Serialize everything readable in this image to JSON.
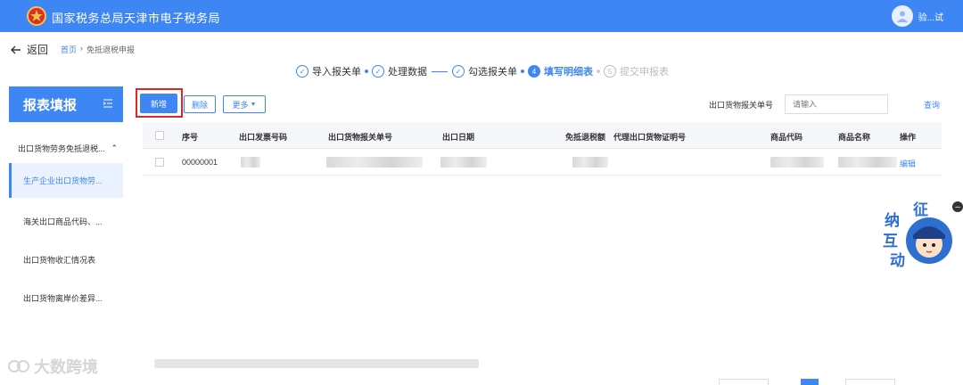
{
  "header": {
    "title": "国家税务总局天津市电子税务局",
    "user_name": "验...试",
    "bg_color": "#3f86f5"
  },
  "nav": {
    "back_label": "返回",
    "breadcrumb_home": "首页",
    "breadcrumb_separator": "›",
    "breadcrumb_current": "免抵退税申报"
  },
  "steps": [
    {
      "label": "导入报关单",
      "state": "done"
    },
    {
      "label": "处理数据",
      "state": "done"
    },
    {
      "label": "勾选报关单",
      "state": "done"
    },
    {
      "label": "填写明细表",
      "state": "active",
      "number": "4"
    },
    {
      "label": "提交申报表",
      "state": "pending",
      "number": "5"
    }
  ],
  "sidebar": {
    "title": "报表填报",
    "group_label": "出口货物劳务免抵退税...",
    "items": [
      {
        "label": "生产企业出口货物劳..."
      },
      {
        "label": "海关出口商品代码、..."
      },
      {
        "label": "出口货物收汇情况表"
      },
      {
        "label": "出口货物离岸价差异..."
      }
    ]
  },
  "toolbar": {
    "add_label": "新增",
    "delete_label": "删除",
    "more_label": "更多",
    "filter_label": "出口货物报关单号",
    "filter_placeholder": "请输入",
    "query_label": "查询"
  },
  "table": {
    "columns": [
      "序号",
      "出口发票号码",
      "出口货物报关单号",
      "出口日期",
      "免抵退税额",
      "代理出口货物证明号",
      "商品代码",
      "商品名称",
      "操作"
    ],
    "rows": [
      {
        "seq": "00000001",
        "action": "编辑"
      }
    ]
  },
  "mascot": {
    "chars": [
      "征",
      "纳",
      "互",
      "动"
    ]
  },
  "watermark": {
    "text": "大数跨境"
  },
  "colors": {
    "accent": "#3f86f5",
    "highlight": "#e32525"
  }
}
